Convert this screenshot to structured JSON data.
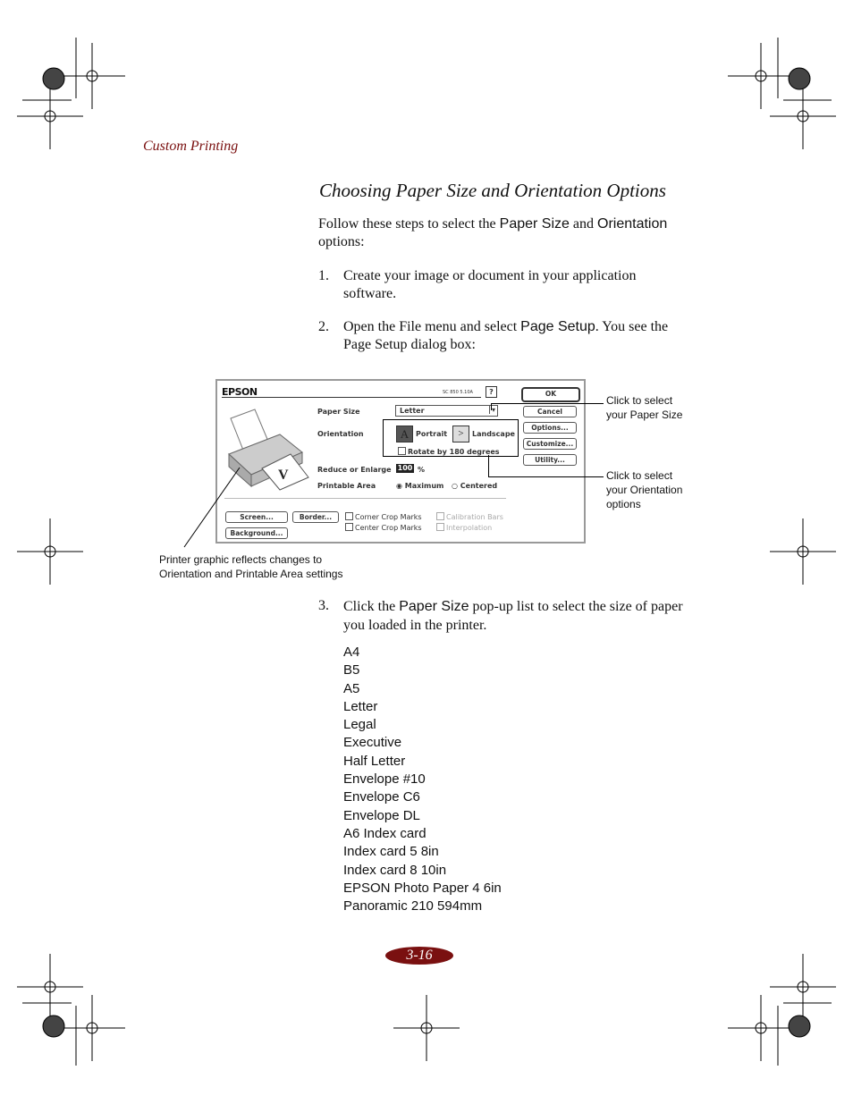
{
  "header": {
    "running_head": "Custom Printing"
  },
  "section": {
    "title": "Choosing Paper Size and Orientation Options",
    "intro_parts": [
      "Follow these steps to select the ",
      "Paper Size",
      " and ",
      "Orientation",
      " options:"
    ],
    "steps": [
      {
        "num": "1.",
        "parts": [
          "Create your image or document in your application software."
        ]
      },
      {
        "num": "2.",
        "parts": [
          "Open the File menu and select ",
          "Page Setup",
          ". You see the Page Setup dialog box:"
        ]
      },
      {
        "num": "3.",
        "parts": [
          "Click the ",
          "Paper Size",
          " pop-up list to select the size of paper you loaded in the printer."
        ]
      }
    ]
  },
  "dialog": {
    "brand": "EPSON",
    "model": "SC 850 5.10A",
    "help": "?",
    "paper_size_label": "Paper Size",
    "paper_size_value": "Letter",
    "orientation_label": "Orientation",
    "portrait": "Portrait",
    "landscape": "Landscape",
    "rotate": "Rotate by 180 degrees",
    "reduce_label": "Reduce or Enlarge",
    "reduce_value": "100",
    "percent": "%",
    "printable_label": "Printable Area",
    "maximum": "Maximum",
    "centered": "Centered",
    "buttons": {
      "ok": "OK",
      "cancel": "Cancel",
      "options": "Options...",
      "customize": "Customize...",
      "utility": "Utility...",
      "screen": "Screen...",
      "border": "Border...",
      "background": "Background..."
    },
    "checks": {
      "corner": "Corner Crop Marks",
      "center": "Center Crop Marks",
      "calibration": "Calibration Bars",
      "interpolation": "Interpolation"
    }
  },
  "callouts": {
    "paper_size": [
      "Click to select",
      "your Paper Size"
    ],
    "orientation": [
      "Click to select",
      "your Orientation",
      "options"
    ],
    "printer_graphic": [
      "Printer graphic reflects changes to",
      "Orientation and Printable Area settings"
    ]
  },
  "paper_sizes": [
    "A4",
    "B5",
    "A5",
    "Letter",
    "Legal",
    "Executive",
    "Half Letter",
    "Envelope #10",
    "Envelope C6",
    "Envelope DL",
    "A6 Index card",
    "Index card 5  8in",
    "Index card 8  10in",
    "EPSON Photo Paper 4  6in",
    "Panoramic 210  594mm"
  ],
  "footer": {
    "page_number": "3-16",
    "accent": "#7a1010"
  }
}
